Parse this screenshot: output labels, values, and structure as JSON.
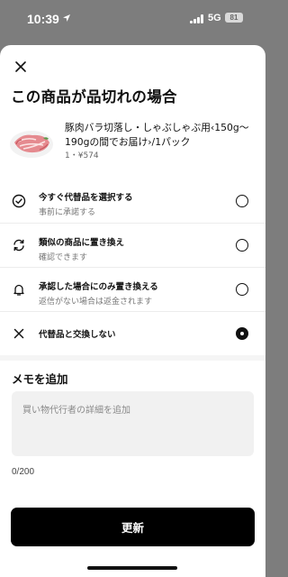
{
  "status_bar": {
    "time": "10:39",
    "network": "5G",
    "battery": "81"
  },
  "sheet": {
    "title": "この商品が品切れの場合",
    "product": {
      "name": "豚肉バラ切落し・しゃぶしゃぶ用‹150g〜190gの間でお届け›/1パック",
      "meta": "1・¥574"
    },
    "options": [
      {
        "icon": "check-circle-icon",
        "title": "今すぐ代替品を選択する",
        "subtitle": "事前に承諾する",
        "selected": false
      },
      {
        "icon": "refresh-icon",
        "title": "類似の商品に置き換え",
        "subtitle": "確認できます",
        "selected": false
      },
      {
        "icon": "bell-icon",
        "title": "承認した場合にのみ置き換える",
        "subtitle": "返信がない場合は返金されます",
        "selected": false
      },
      {
        "icon": "close-icon",
        "title": "代替品と交換しない",
        "subtitle": "",
        "selected": true
      }
    ],
    "memo": {
      "title": "メモを追加",
      "placeholder": "買い物代行者の詳細を追加",
      "value": "",
      "counter": "0/200"
    },
    "update_label": "更新"
  },
  "colors": {
    "primary": "#000000",
    "backdrop": "#7d7d7d",
    "input_bg": "#f1f1f1"
  }
}
